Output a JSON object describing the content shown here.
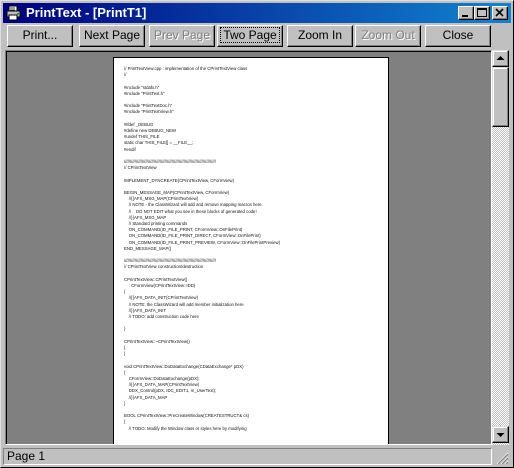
{
  "window": {
    "title": "PrintText - [PrintT1]",
    "icon": "printer-app-icon",
    "caption_buttons": [
      "minimize-icon",
      "maximize-icon",
      "close-icon"
    ]
  },
  "toolbar": {
    "print_label": "Print...",
    "next_page_label": "Next Page",
    "prev_page_label": "Prev Page",
    "two_page_label": "Two Page",
    "zoom_in_label": "Zoom In",
    "zoom_out_label": "Zoom Out",
    "close_label": "Close"
  },
  "preview": {
    "lines": [
      "// PrintTextView.cpp : implementation of the CPrintTextView class",
      "//",
      "",
      "#include \"stdafx.h\"",
      "#include \"PrintText.h\"",
      "",
      "#include \"PrintTextDoc.h\"",
      "#include \"PrintTextView.h\"",
      "",
      "#ifdef _DEBUG",
      "#define new DEBUG_NEW",
      "#undef THIS_FILE",
      "static char THIS_FILE[] = __FILE__;",
      "#endif",
      "",
      "/////////////////////////////////////////////////////////////////////////////",
      "// CPrintTextView",
      "",
      "IMPLEMENT_DYNCREATE(CPrintTextView, CFormView)",
      "",
      "BEGIN_MESSAGE_MAP(CPrintTextView, CFormView)",
      "    //{{AFX_MSG_MAP(CPrintTextView)",
      "    // NOTE - the ClassWizard will add and remove mapping macros here.",
      "    //    DO NOT EDIT what you see in these blocks of generated code!",
      "    //}}AFX_MSG_MAP",
      "    // Standard printing commands",
      "    ON_COMMAND(ID_FILE_PRINT, CFormView::OnFilePrint)",
      "    ON_COMMAND(ID_FILE_PRINT_DIRECT, CFormView::OnFilePrint)",
      "    ON_COMMAND(ID_FILE_PRINT_PREVIEW, CFormView::OnFilePrintPreview)",
      "END_MESSAGE_MAP()",
      "",
      "/////////////////////////////////////////////////////////////////////////////",
      "// CPrintTextView construction/destruction",
      "",
      "CPrintTextView::CPrintTextView()",
      "    : CFormView(CPrintTextView::IDD)",
      "{",
      "    //{{AFX_DATA_INIT(CPrintTextView)",
      "    // NOTE: the ClassWizard will add member initialization here",
      "    //}}AFX_DATA_INIT",
      "    // TODO: add construction code here",
      "",
      "}",
      "",
      "CPrintTextView::~CPrintTextView()",
      "{",
      "}",
      "",
      "void CPrintTextView::DoDataExchange(CDataExchange* pDX)",
      "{",
      "    CFormView::DoDataExchange(pDX);",
      "    //{{AFX_DATA_MAP(CPrintTextView)",
      "    DDX_Control(pDX, IDC_EDIT1, m_UserText);",
      "    //}}AFX_DATA_MAP",
      "}",
      "",
      "BOOL CPrintTextView::PreCreateWindow(CREATESTRUCT& cs)",
      "{",
      "    // TODO: Modify the Window class or styles here by modifying"
    ]
  },
  "status": {
    "page_label": "Page 1"
  }
}
